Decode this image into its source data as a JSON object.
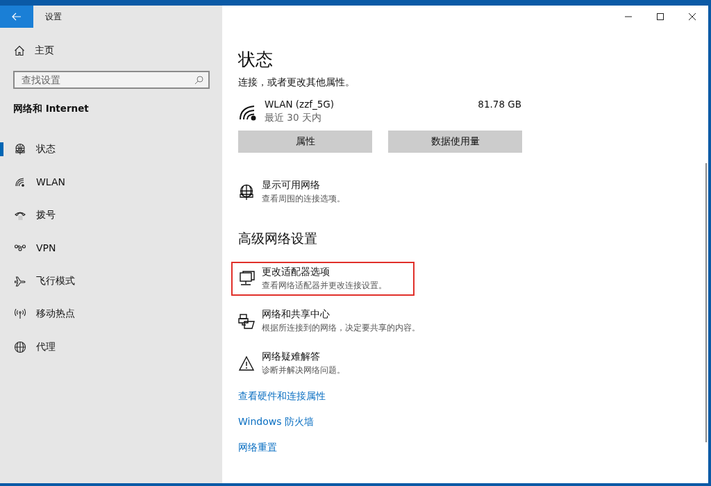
{
  "window": {
    "title": "设置"
  },
  "sidebar": {
    "home": "主页",
    "search": {
      "placeholder": "查找设置"
    },
    "section": "网络和 Internet",
    "items": [
      {
        "kind": "status",
        "label": "状态",
        "selected": true
      },
      {
        "kind": "wifi",
        "label": "WLAN",
        "selected": false
      },
      {
        "kind": "dialup",
        "label": "拨号",
        "selected": false
      },
      {
        "kind": "vpn",
        "label": "VPN",
        "selected": false
      },
      {
        "kind": "airplane",
        "label": "飞行模式",
        "selected": false
      },
      {
        "kind": "hotspot",
        "label": "移动热点",
        "selected": false
      },
      {
        "kind": "proxy",
        "label": "代理",
        "selected": false
      }
    ]
  },
  "content": {
    "title": "状态",
    "intro": "连接，或者更改其他属性。",
    "connection": {
      "name": "WLAN (zzf_5G)",
      "period": "最近 30 天内",
      "usage": "81.78 GB"
    },
    "buttons": [
      "属性",
      "数据使用量"
    ],
    "show_networks": {
      "title": "显示可用网络",
      "description": "查看周围的连接选项。"
    },
    "advanced_heading": "高级网络设置",
    "options": [
      {
        "kind": "adapter",
        "title": "更改适配器选项",
        "description": "查看网络适配器并更改连接设置。",
        "highlighted": true
      },
      {
        "kind": "sharing",
        "title": "网络和共享中心",
        "description": "根据所连接到的网络，决定要共享的内容。",
        "highlighted": false
      },
      {
        "kind": "troubleshoot",
        "title": "网络疑难解答",
        "description": "诊断并解决网络问题。",
        "highlighted": false
      }
    ],
    "links": [
      "查看硬件和连接属性",
      "Windows 防火墙",
      "网络重置"
    ]
  }
}
